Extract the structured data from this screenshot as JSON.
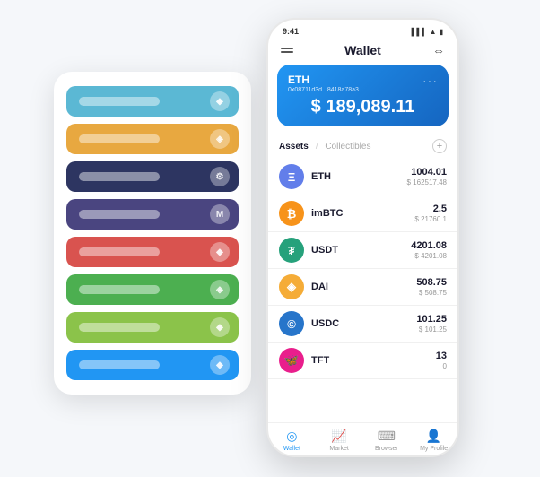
{
  "background_cards": [
    {
      "color": "#5bb8d4",
      "icon": "◆"
    },
    {
      "color": "#e8a840",
      "icon": "◈"
    },
    {
      "color": "#2d3561",
      "icon": "⚙"
    },
    {
      "color": "#4a4580",
      "icon": "M"
    },
    {
      "color": "#d9534f",
      "icon": "◆"
    },
    {
      "color": "#4caf50",
      "icon": "◈"
    },
    {
      "color": "#8bc34a",
      "icon": "◆"
    },
    {
      "color": "#2196f3",
      "icon": "◆"
    }
  ],
  "phone": {
    "status_time": "9:41",
    "title": "Wallet",
    "eth_card": {
      "label": "ETH",
      "address": "0x08711d3d...8418a78a3",
      "amount": "$ 189,089.11",
      "currency_symbol": "$"
    },
    "assets_tab": "Assets",
    "collectibles_tab": "Collectibles",
    "add_button": "+",
    "assets": [
      {
        "name": "ETH",
        "amount": "1004.01",
        "usd": "$ 162517.48",
        "color": "#627EEA",
        "symbol": "Ξ"
      },
      {
        "name": "imBTC",
        "amount": "2.5",
        "usd": "$ 21760.1",
        "color": "#F7931A",
        "symbol": "₿"
      },
      {
        "name": "USDT",
        "amount": "4201.08",
        "usd": "$ 4201.08",
        "color": "#26A17B",
        "symbol": "T"
      },
      {
        "name": "DAI",
        "amount": "508.75",
        "usd": "$ 508.75",
        "color": "#F5AC37",
        "symbol": "D"
      },
      {
        "name": "USDC",
        "amount": "101.25",
        "usd": "$ 101.25",
        "color": "#2775CA",
        "symbol": "C"
      },
      {
        "name": "TFT",
        "amount": "13",
        "usd": "0",
        "color": "#E91E8C",
        "symbol": "T"
      }
    ],
    "nav": [
      {
        "label": "Wallet",
        "active": true
      },
      {
        "label": "Market",
        "active": false
      },
      {
        "label": "Browser",
        "active": false
      },
      {
        "label": "My Profile",
        "active": false
      }
    ]
  }
}
